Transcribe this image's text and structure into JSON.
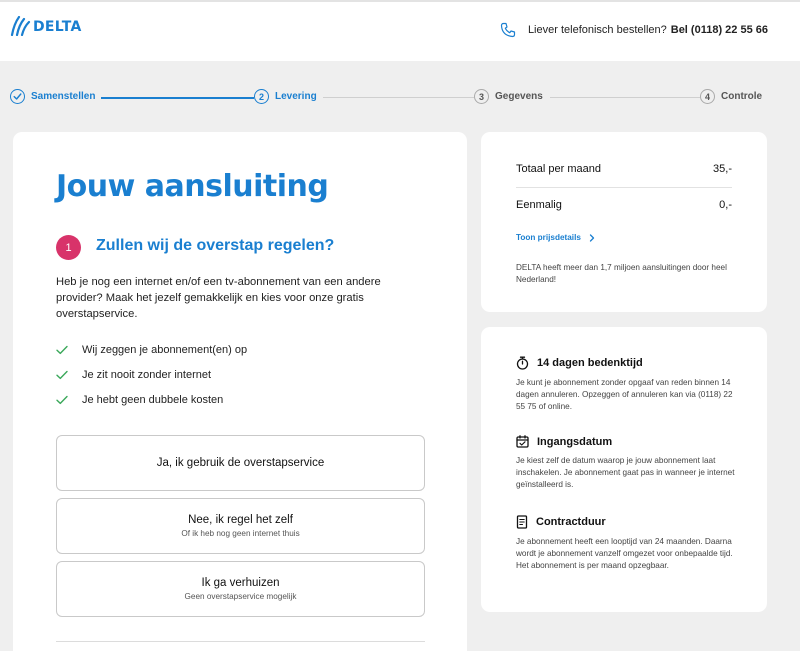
{
  "header": {
    "logo_text": "DELTA",
    "phone_prefix": "Liever telefonisch bestellen?",
    "phone_strong": "Bel (0118) 22 55 66",
    "phone_icon": "phone-icon",
    "brand_color": "#1a7fd0"
  },
  "stepper": {
    "steps": [
      {
        "number": "",
        "label": "Samenstellen",
        "state": "done"
      },
      {
        "number": "2",
        "label": "Levering",
        "state": "current"
      },
      {
        "number": "3",
        "label": "Gegevens",
        "state": "todo"
      },
      {
        "number": "4",
        "label": "Controle",
        "state": "todo"
      }
    ]
  },
  "main": {
    "title": "Jouw aansluiting",
    "section_number": "1",
    "section_title": "Zullen wij de overstap regelen?",
    "intro": "Heb je nog een internet en/of een tv-abonnement van een andere provider? Maak het jezelf gemakkelijk en kies voor onze gratis overstapservice.",
    "benefits": [
      "Wij zeggen je abonnement(en) op",
      "Je zit nooit zonder internet",
      "Je hebt geen dubbele kosten"
    ],
    "options": [
      {
        "title": "Ja, ik gebruik de overstapservice",
        "subtitle": ""
      },
      {
        "title": "Nee, ik regel het zelf",
        "subtitle": "Of ik heb nog geen internet thuis"
      },
      {
        "title": "Ik ga verhuizen",
        "subtitle": "Geen overstapservice mogelijk"
      }
    ],
    "badge_color": "#d8336a"
  },
  "summary": {
    "monthly_label": "Totaal per maand",
    "monthly_value": "35,-",
    "once_label": "Eenmalig",
    "once_value": "0,-",
    "details_link": "Toon prijsdetails",
    "note": "DELTA heeft meer dan 1,7 miljoen aansluitingen door heel Nederland!"
  },
  "info": {
    "blocks": [
      {
        "icon": "stopwatch-icon",
        "title": "14 dagen bedenktijd",
        "text": "Je kunt je abonnement zonder opgaaf van reden binnen 14 dagen annuleren. Opzeggen of annuleren kan via (0118) 22 55 75 of online."
      },
      {
        "icon": "calendar-icon",
        "title": "Ingangsdatum",
        "text": "Je kiest zelf de datum waarop je jouw abonnement laat inschakelen. Je abonnement gaat pas in wanneer je internet geïnstalleerd is."
      },
      {
        "icon": "document-icon",
        "title": "Contractduur",
        "text": "Je abonnement heeft een looptijd van 24 maanden. Daarna wordt je abonnement vanzelf omgezet voor onbepaalde tijd. Het abonnement is per maand opzegbaar."
      }
    ]
  }
}
